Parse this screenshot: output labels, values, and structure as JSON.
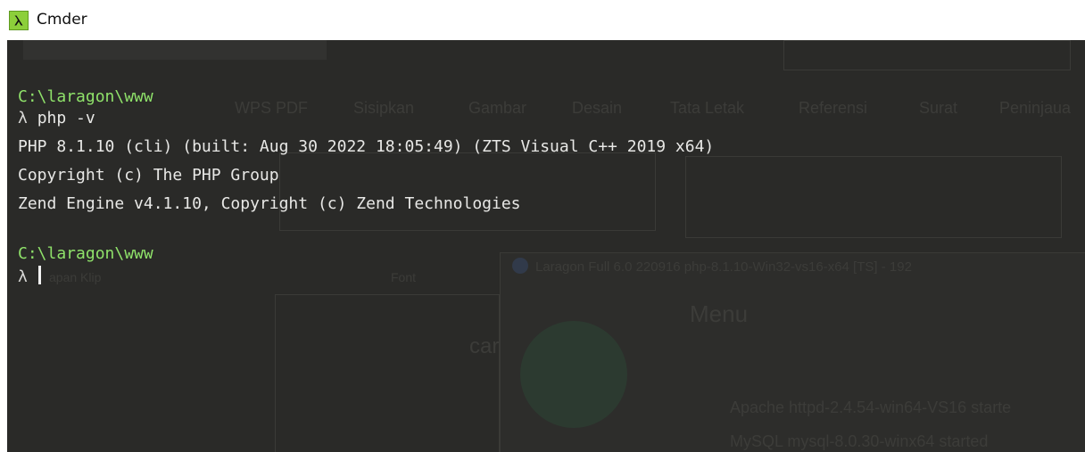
{
  "window": {
    "title": "Cmder",
    "icon": "lambda-icon",
    "icon_glyph": "λ",
    "icon_color": "#8ccf3a"
  },
  "terminal": {
    "background": "#2a2a28",
    "path_color": "#8fe26a",
    "text_color": "#e8e8e6",
    "lines": [
      {
        "type": "path",
        "text": "C:\\laragon\\www"
      },
      {
        "type": "command",
        "prompt": "λ",
        "text": "php -v"
      },
      {
        "type": "output",
        "text": "PHP 8.1.10 (cli) (built: Aug 30 2022 18:05:49) (ZTS Visual C++ 2019 x64)"
      },
      {
        "type": "output",
        "text": "Copyright (c) The PHP Group"
      },
      {
        "type": "output",
        "text": "Zend Engine v4.1.10, Copyright (c) Zend Technologies"
      },
      {
        "type": "path",
        "text": "C:\\laragon\\www"
      },
      {
        "type": "command",
        "prompt": "λ",
        "text": ""
      }
    ]
  },
  "background_ghost": {
    "ribbon_tabs": [
      "WPS PDF",
      "Sisipkan",
      "Gambar",
      "Desain",
      "Tata Letak",
      "Referensi",
      "Surat",
      "Peninjaua"
    ],
    "labels": {
      "font_group": "Font",
      "clipboard": "apan Klip",
      "laragon_title": "Laragon Full 6.0 220916 php-8.1.10-Win32-vs16-x64 [TS] - 192",
      "menu": "Menu",
      "doc_text": "car",
      "apache_status": "Apache httpd-2.4.54-win64-VS16 starte",
      "mysql_status": "MySQL mysql-8.0.30-winx64 started"
    }
  }
}
